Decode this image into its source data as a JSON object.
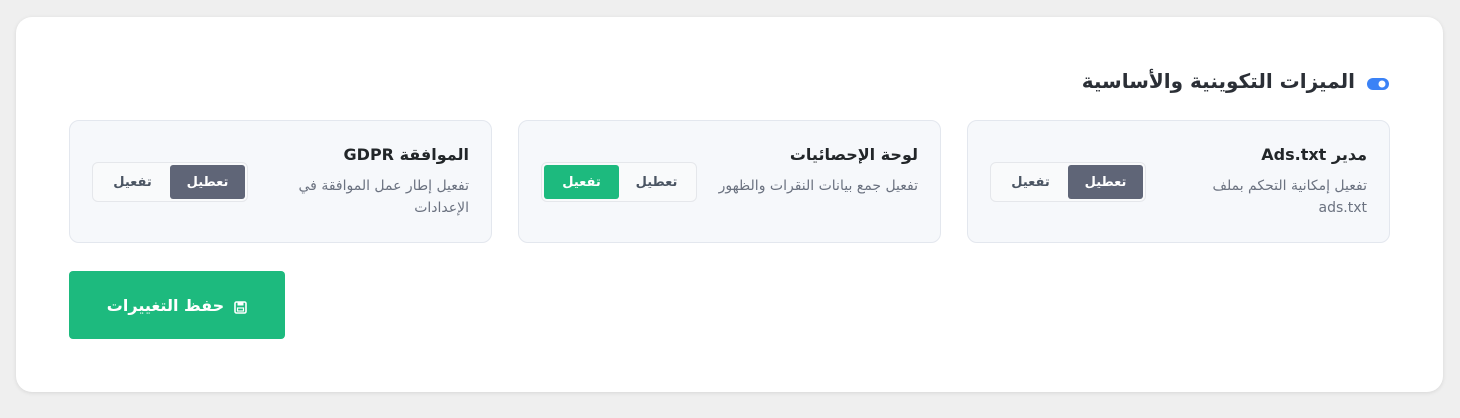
{
  "section": {
    "title": "الميزات التكوينية والأساسية",
    "icon": "toggle-icon",
    "icon_color": "#3b82f6"
  },
  "features": [
    {
      "title": "مدير Ads.txt",
      "description": "تفعيل إمكانية التحكم بملف ads.txt",
      "disable_label": "تعطيل",
      "enable_label": "تفعيل",
      "state": "disabled"
    },
    {
      "title": "لوحة الإحصائيات",
      "description": "تفعيل جمع بيانات النقرات والظهور",
      "disable_label": "تعطيل",
      "enable_label": "تفعيل",
      "state": "enabled"
    },
    {
      "title": "الموافقة GDPR",
      "description": "تفعيل إطار عمل الموافقة في الإعدادات",
      "disable_label": "تعطيل",
      "enable_label": "تفعيل",
      "state": "disabled"
    }
  ],
  "save_button": {
    "label": "حفظ التغييرات",
    "icon": "save-icon"
  },
  "colors": {
    "accent_green": "#1dba7e",
    "disabled_active": "#5f6577",
    "toggle_blue": "#3b82f6"
  }
}
